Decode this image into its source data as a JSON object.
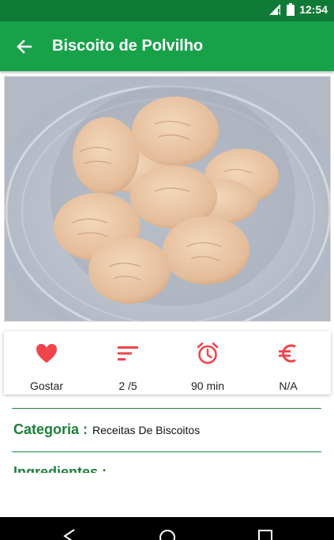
{
  "status_bar": {
    "time": "12:54",
    "icons": [
      "signal-icon",
      "battery-icon"
    ]
  },
  "app_bar": {
    "title": "Biscoito de Polvilho",
    "back_icon": "arrow-left-icon"
  },
  "recipe_photo": {
    "alt": "Biscoito de Polvilho"
  },
  "info": [
    {
      "icon": "heart-icon",
      "label": "Gostar"
    },
    {
      "icon": "difficulty-icon",
      "label": "2 /5"
    },
    {
      "icon": "alarm-clock-icon",
      "label": "90 min"
    },
    {
      "icon": "euro-icon",
      "label": "N/A"
    }
  ],
  "details": {
    "category_label": "Categoria :",
    "category_value": "Receitas De Biscoitos",
    "ingredients_label": "Ingredientes :"
  },
  "nav_bar": {
    "buttons": [
      "back-triangle-icon",
      "home-circle-icon",
      "recents-square-icon"
    ]
  },
  "colors": {
    "primary": "#17a24a",
    "primary_dark": "#0f7a35",
    "accent": "#f0444a",
    "label_green": "#1b7f3a"
  }
}
